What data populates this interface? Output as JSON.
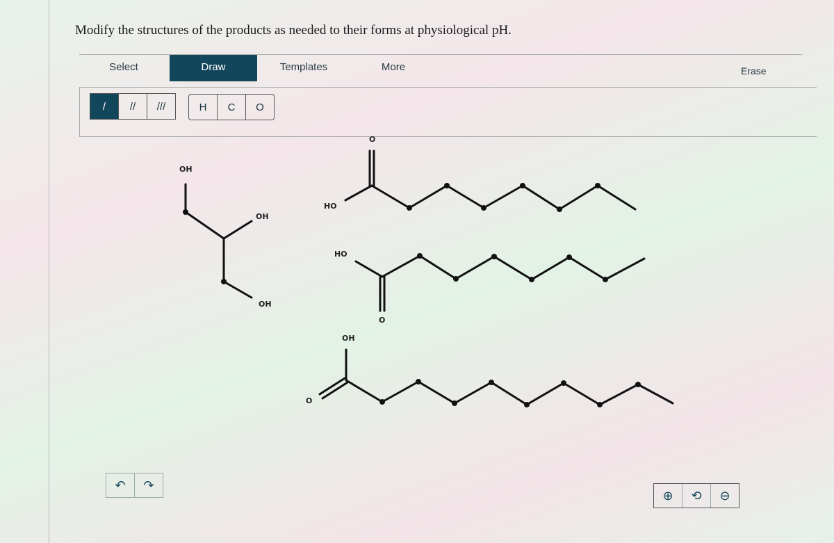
{
  "prompt": "Modify the structures of the products as needed to their forms at physiological pH.",
  "tabs": [
    {
      "label": "Select"
    },
    {
      "label": "Draw",
      "active": true
    },
    {
      "label": "Templates"
    },
    {
      "label": "More"
    }
  ],
  "erase_label": "Erase",
  "bond_tools": [
    {
      "icon": "single-bond-icon",
      "glyph": "/"
    },
    {
      "icon": "double-bond-icon",
      "glyph": "//"
    },
    {
      "icon": "triple-bond-icon",
      "glyph": "///"
    }
  ],
  "atom_tools": [
    "H",
    "C",
    "O"
  ],
  "molecules": {
    "glycerol": {
      "labels": [
        "OH",
        "OH",
        "OH"
      ]
    },
    "acid1": {
      "labels": [
        "O",
        "HO"
      ]
    },
    "acid2": {
      "labels": [
        "HO",
        "O"
      ]
    },
    "acid3": {
      "labels": [
        "OH",
        "O"
      ]
    }
  },
  "bottom_left": [
    {
      "icon": "undo-icon",
      "glyph": "↶"
    },
    {
      "icon": "redo-icon",
      "glyph": "↷"
    }
  ],
  "bottom_right": [
    {
      "icon": "zoom-in-icon",
      "glyph": "⊕"
    },
    {
      "icon": "reset-zoom-icon",
      "glyph": "⟲"
    },
    {
      "icon": "zoom-out-icon",
      "glyph": "⊖"
    }
  ],
  "colors": {
    "accent": "#12465a"
  }
}
